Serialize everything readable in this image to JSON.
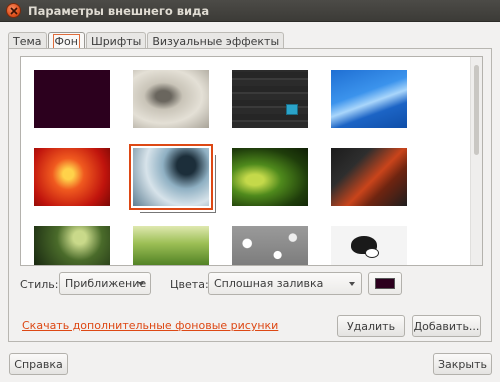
{
  "window": {
    "title": "Параметры внешнего вида"
  },
  "tabs": [
    {
      "label": "Тема",
      "active": false
    },
    {
      "label": "Фон",
      "active": true
    },
    {
      "label": "Шрифты",
      "active": false
    },
    {
      "label": "Визуальные эффекты",
      "active": false
    }
  ],
  "wallpapers": [
    {
      "name": "solid-dark-purple",
      "selected": false
    },
    {
      "name": "snail",
      "selected": false
    },
    {
      "name": "dark-wood-cube",
      "selected": false
    },
    {
      "name": "blue-abstract",
      "selected": false
    },
    {
      "name": "red-berries-drops",
      "selected": false
    },
    {
      "name": "water-drops-tap",
      "selected": true
    },
    {
      "name": "green-leaves",
      "selected": false
    },
    {
      "name": "red-feather",
      "selected": false
    },
    {
      "name": "fern-dark",
      "selected": false
    },
    {
      "name": "grass",
      "selected": false
    },
    {
      "name": "water-droplets",
      "selected": false
    },
    {
      "name": "dog-silhouette",
      "selected": false
    }
  ],
  "controls": {
    "style_label": "Стиль:",
    "style_value": "Приближение",
    "colors_label": "Цвета:",
    "colors_value": "Сплошная заливка",
    "color_value": "#2c001e"
  },
  "download_link": "Скачать дополнительные фоновые рисунки",
  "buttons": {
    "remove": "Удалить",
    "add": "Добавить...",
    "help": "Справка",
    "close": "Закрыть"
  }
}
